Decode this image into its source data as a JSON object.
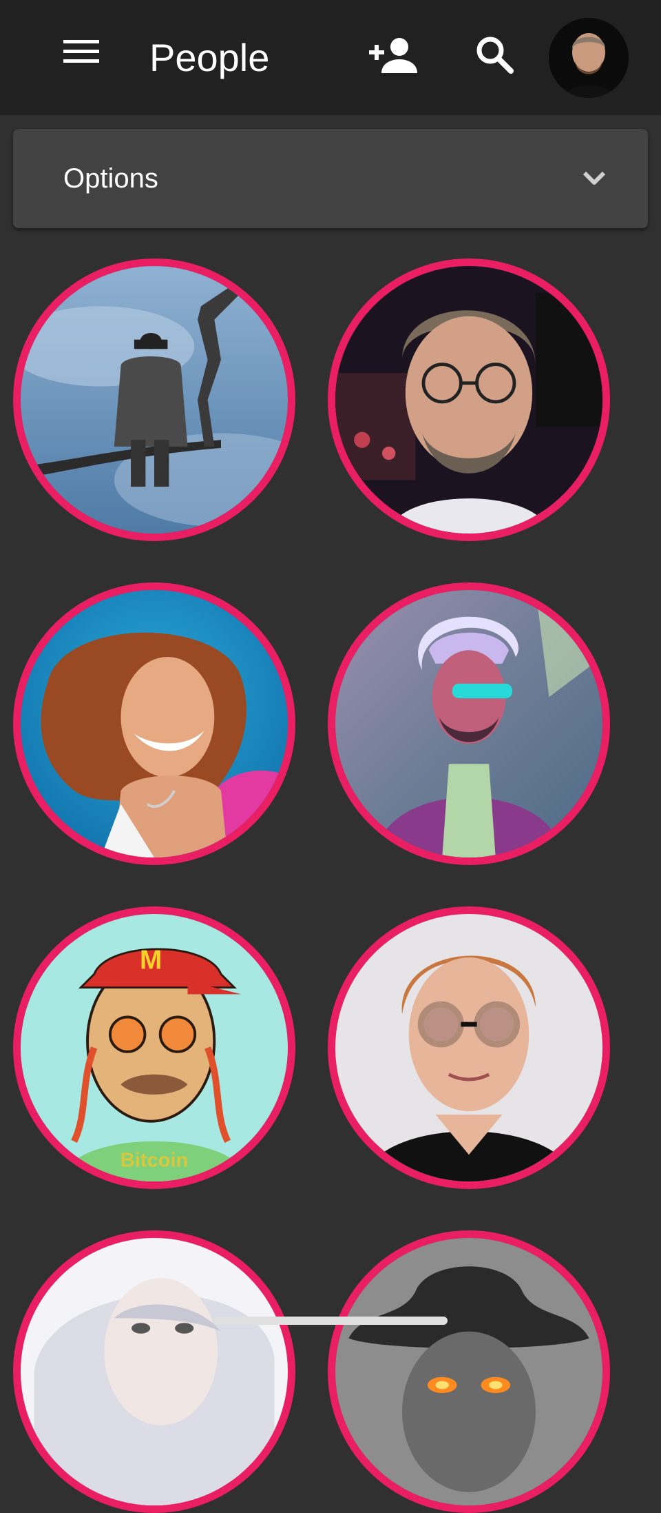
{
  "app_bar": {
    "title": "People",
    "icons": {
      "menu": "menu-icon",
      "add_person": "person-add-icon",
      "search": "search-icon"
    }
  },
  "options": {
    "label": "Options",
    "icon": "chevron-down-icon"
  },
  "colors": {
    "app_bar_bg": "#212121",
    "page_bg": "#303030",
    "panel_bg": "#424242",
    "avatar_ring": "#e91e63",
    "text": "#ffffff"
  },
  "people_grid": {
    "visible_count": 8
  }
}
